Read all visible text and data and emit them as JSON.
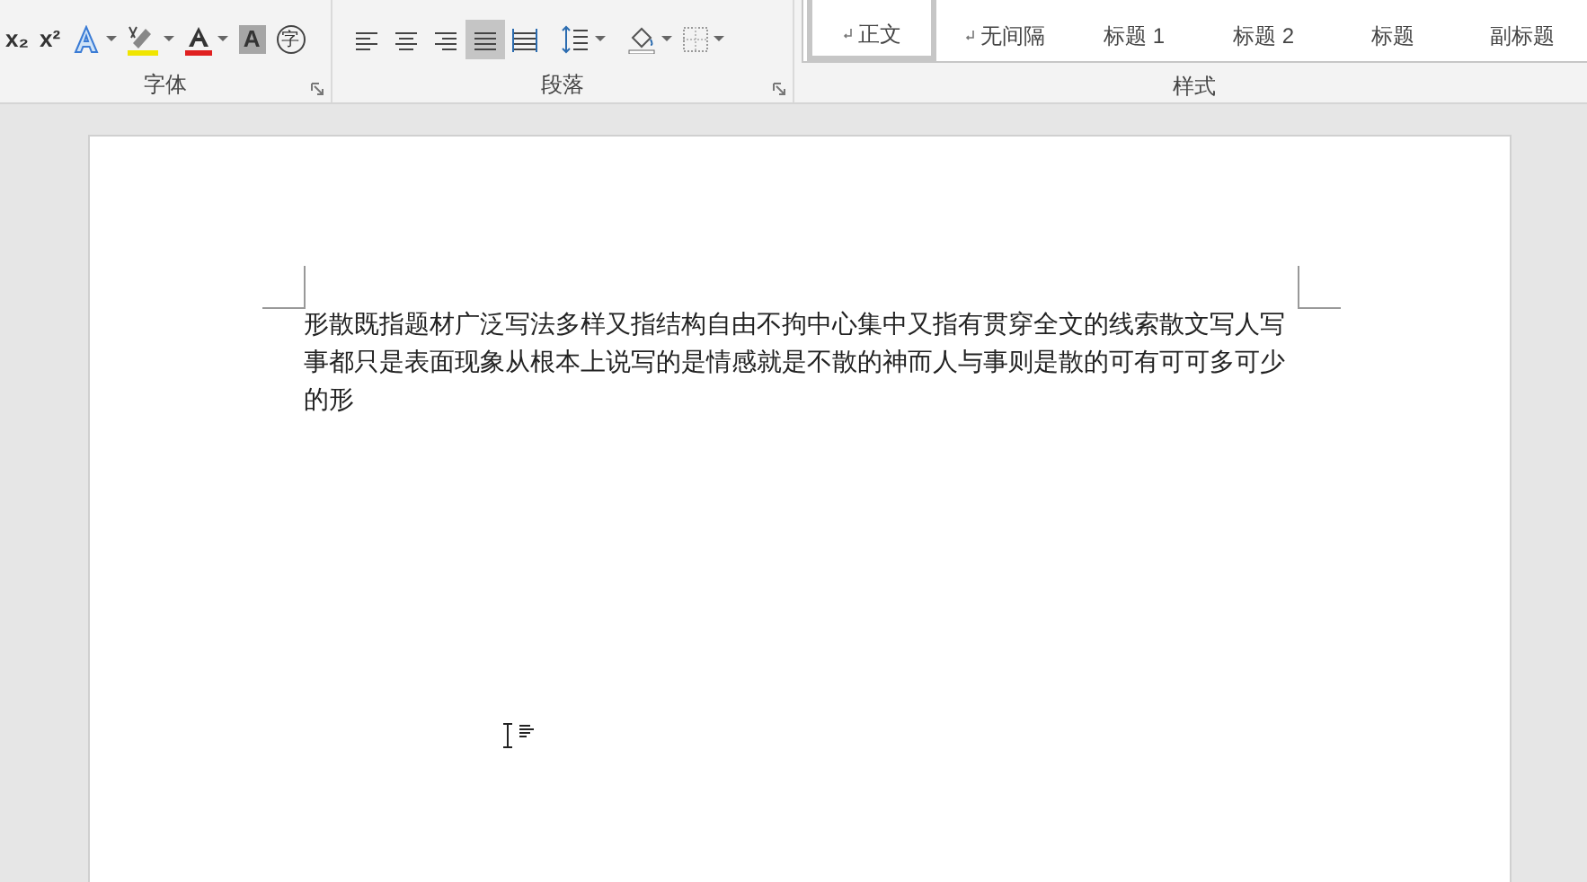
{
  "ribbon": {
    "groups": [
      {
        "label": "字体",
        "tools": [
          {
            "kind": "subscript",
            "text": "x₂"
          },
          {
            "kind": "superscript",
            "text": "x²"
          },
          {
            "kind": "effects"
          },
          {
            "kind": "highlight"
          },
          {
            "kind": "fontcolor"
          },
          {
            "kind": "shading",
            "text": "A"
          },
          {
            "kind": "enclose",
            "text": "字"
          }
        ]
      },
      {
        "label": "段落",
        "tools": [
          {
            "kind": "align-left",
            "selected": false
          },
          {
            "kind": "align-center",
            "selected": false
          },
          {
            "kind": "align-right",
            "selected": false
          },
          {
            "kind": "justify",
            "selected": true
          },
          {
            "kind": "distributed",
            "selected": false
          },
          {
            "kind": "line-spacing"
          },
          {
            "kind": "fill"
          },
          {
            "kind": "borders"
          }
        ]
      }
    ],
    "styles": {
      "label": "样式",
      "items": [
        {
          "label": "正文",
          "mark": true,
          "selected": true
        },
        {
          "label": "无间隔",
          "mark": true,
          "selected": false
        },
        {
          "label": "标题 1",
          "mark": false,
          "selected": false
        },
        {
          "label": "标题 2",
          "mark": false,
          "selected": false
        },
        {
          "label": "标题",
          "mark": false,
          "selected": false
        },
        {
          "label": "副标题",
          "mark": false,
          "selected": false
        }
      ]
    }
  },
  "document": {
    "paragraph": "形散既指题材广泛写法多样又指结构自由不拘中心集中又指有贯穿全文的线索散文写人写事都只是表面现象从根本上说写的是情感就是不散的神而人与事则是散的可有可可多可少的形"
  }
}
